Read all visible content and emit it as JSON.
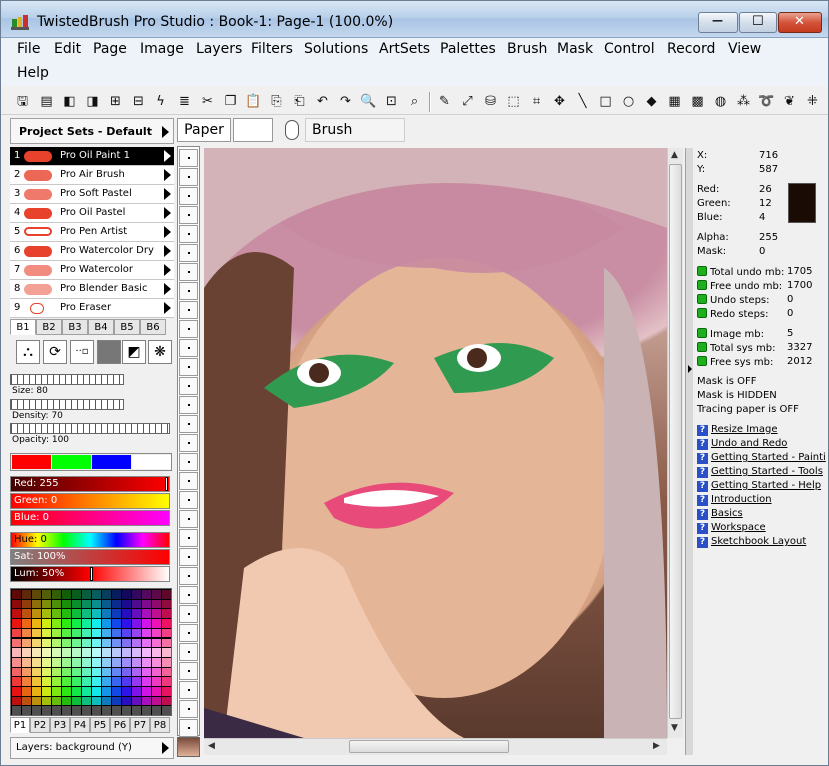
{
  "window": {
    "title": "TwistedBrush Pro Studio : Book-1: Page-1 (100.0%)",
    "min_glyph": "—",
    "max_glyph": "☐",
    "close_glyph": "✕"
  },
  "menu": [
    "File",
    "Edit",
    "Page",
    "Image",
    "Layers",
    "Filters",
    "Solutions",
    "ArtSets",
    "Palettes",
    "Brush",
    "Mask",
    "Control",
    "Record",
    "View",
    "Help"
  ],
  "toolbar": {
    "icons": [
      "save-icon",
      "floppy-icon",
      "page-prev-icon",
      "page-next-icon",
      "page-add-icon",
      "page-remove-icon",
      "lightning-icon",
      "page-text-icon",
      "scissors-icon",
      "copy-icon",
      "paste-icon",
      "paste-new-icon",
      "paste-special-icon",
      "undo-icon",
      "redo-icon",
      "zoom-icon",
      "zoom-fit-icon",
      "magnifier-icon",
      "brush-icon",
      "eyedropper-icon",
      "bucket-icon",
      "selection-icon",
      "crop-icon",
      "move-icon",
      "line-icon",
      "rectangle-icon",
      "ellipse-icon",
      "fill-icon",
      "pattern-icon",
      "checker-icon",
      "texture-icon",
      "wand-icon",
      "lasso-icon",
      "smudge-icon",
      "grid-icon"
    ]
  },
  "left_panel": {
    "project_sets_title": "Project Sets - Default",
    "brushes": [
      {
        "num": "1",
        "name": "Pro Oil Paint 1",
        "selected": true
      },
      {
        "num": "2",
        "name": "Pro Air Brush"
      },
      {
        "num": "3",
        "name": "Pro Soft Pastel"
      },
      {
        "num": "4",
        "name": "Pro Oil Pastel"
      },
      {
        "num": "5",
        "name": "Pro Pen Artist"
      },
      {
        "num": "6",
        "name": "Pro Watercolor Dry"
      },
      {
        "num": "7",
        "name": "Pro Watercolor"
      },
      {
        "num": "8",
        "name": "Pro Blender Basic"
      },
      {
        "num": "9",
        "name": "Pro Eraser"
      }
    ],
    "brush_tabs": [
      "B1",
      "B2",
      "B3",
      "B4",
      "B5",
      "B6"
    ],
    "sliders": [
      {
        "label": "Size: 80"
      },
      {
        "label": "Density: 70"
      },
      {
        "label": "Opacity: 100"
      }
    ],
    "color_bars": [
      {
        "label": "Red: 255"
      },
      {
        "label": "Green: 0"
      },
      {
        "label": "Blue: 0"
      },
      {
        "label": "Hue: 0"
      },
      {
        "label": "Sat: 100%"
      },
      {
        "label": "Lum: 50%"
      }
    ],
    "palette_tabs": [
      "P1",
      "P2",
      "P3",
      "P4",
      "P5",
      "P6",
      "P7",
      "P8"
    ],
    "layers_label": "Layers: background (Y)"
  },
  "paper": {
    "label": "Paper",
    "brush_label": "Brush"
  },
  "info": {
    "x_label": "X:",
    "x_value": "716",
    "y_label": "Y:",
    "y_value": "587",
    "red_label": "Red:",
    "red_value": "26",
    "green_label": "Green:",
    "green_value": "12",
    "blue_label": "Blue:",
    "blue_value": "4",
    "alpha_label": "Alpha:",
    "alpha_value": "255",
    "mask_label": "Mask:",
    "mask_value": "0",
    "swatch_color": "#1a0c04",
    "stats": [
      {
        "label": "Total undo mb:",
        "value": "1705"
      },
      {
        "label": "Free undo mb:",
        "value": "1700"
      },
      {
        "label": "Undo steps:",
        "value": "0"
      },
      {
        "label": "Redo steps:",
        "value": "0"
      },
      {
        "label": "Image mb:",
        "value": "5"
      },
      {
        "label": "Total sys mb:",
        "value": "3327"
      },
      {
        "label": "Free sys mb:",
        "value": "2012"
      }
    ],
    "status": [
      "Mask is OFF",
      "Mask is HIDDEN",
      "Tracing paper is OFF"
    ],
    "help_links": [
      "Resize Image",
      "Undo and Redo",
      "Getting Started - Painti",
      "Getting Started - Tools",
      "Getting Started - Help",
      "Introduction",
      "Basics",
      "Workspace",
      "Sketchbook Layout"
    ]
  }
}
